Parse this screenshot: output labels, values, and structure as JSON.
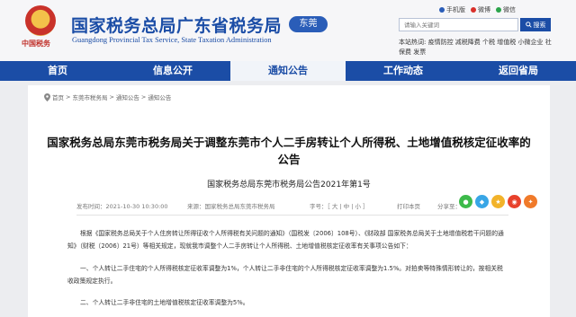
{
  "header": {
    "emblem_text": "中国税务",
    "title": "国家税务总局广东省税务局",
    "subtitle": "Guangdong Provincial Tax Service, State Taxation Administration",
    "city": "东莞",
    "top_links": [
      {
        "label": "手机版",
        "icon": "mobile-icon",
        "color": "#2a5db8"
      },
      {
        "label": "微博",
        "icon": "weibo-icon",
        "color": "#d9302a"
      },
      {
        "label": "微信",
        "icon": "wechat-icon",
        "color": "#2aa34a"
      }
    ],
    "search": {
      "placeholder": "请输入关键词",
      "button_label": "搜索"
    },
    "hot_words": "本站热词: 疫情防控 减税降费 个税 增值税 小微企业 社保费 发票"
  },
  "nav": {
    "items": [
      {
        "label": "首页",
        "active": false
      },
      {
        "label": "信息公开",
        "active": false
      },
      {
        "label": "通知公告",
        "active": true
      },
      {
        "label": "工作动态",
        "active": false
      },
      {
        "label": "返回省局",
        "active": false
      }
    ]
  },
  "breadcrumb": {
    "items": [
      "首页",
      "东莞市税务局",
      "通知公告",
      "通知公告"
    ],
    "separator": ">"
  },
  "article": {
    "title": "国家税务总局东莞市税务局关于调整东莞市个人二手房转让个人所得税、土地增值税核定征收率的公告",
    "doc_number": "国家税务总局东莞市税务局公告2021年第1号",
    "meta": {
      "publish_time": "发布时间：2021-10-30 10:30:00",
      "source": "来源：国家税务总局东莞市税务局",
      "font_size": "字号：［ 大 | 中 | 小 ］",
      "print": "打印本页",
      "share": "分享至："
    },
    "share_icons": [
      {
        "name": "wechat",
        "color": "#3dba4a",
        "glyph": "●"
      },
      {
        "name": "qq",
        "color": "#38a6e6",
        "glyph": "◆"
      },
      {
        "name": "qzone",
        "color": "#f2b32a",
        "glyph": "★"
      },
      {
        "name": "weibo",
        "color": "#e8412b",
        "glyph": "◉"
      },
      {
        "name": "more",
        "color": "#f07a2a",
        "glyph": "✦"
      }
    ],
    "paragraphs": [
      "根据《国家税务总局关于个人住房转让所得征收个人所得税有关问题的通知》（国税发〔2006〕108号）、《财政部 国家税务总局关于土地增值税若干问题的通知》（财税〔2006〕21号）等相关规定，现就我市调整个人二手房转让个人所得税、土地增值税核定征收率有关事项公告如下：",
      "一、个人转让二手住宅的个人所得税核定征收率调整为1%，个人转让二手非住宅的个人所得税核定征收率调整为1.5%。对拍卖等特殊情形转让的，按相关税收政策规定执行。",
      "二、个人转让二手非住宅的土地增值税核定征收率调整为5%。"
    ]
  }
}
